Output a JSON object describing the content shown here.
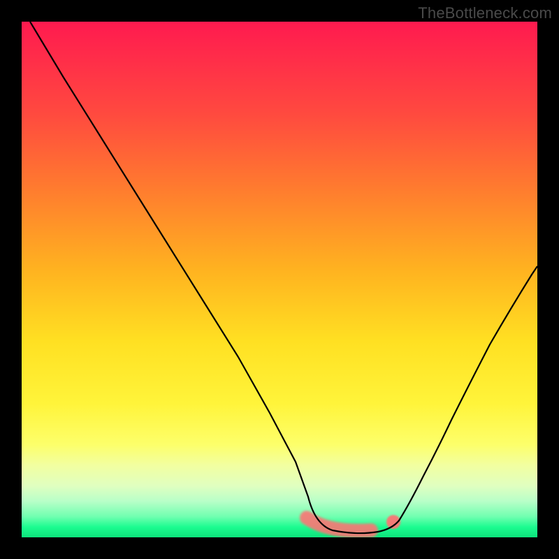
{
  "watermark": "TheBottleneck.com",
  "colors": {
    "background": "#000000",
    "gradient_top": "#ff1a4f",
    "gradient_mid": "#ffe022",
    "gradient_bottom": "#0ce47c",
    "curve": "#000000",
    "glow": "#fc7474"
  },
  "chart_data": {
    "type": "line",
    "title": "",
    "xlabel": "",
    "ylabel": "",
    "xlim": [
      0,
      100
    ],
    "ylim": [
      0,
      100
    ],
    "x": [
      0,
      5,
      10,
      15,
      20,
      25,
      30,
      35,
      40,
      45,
      50,
      55,
      56,
      57,
      58,
      59,
      60,
      62,
      64,
      66,
      68,
      70,
      72,
      74,
      76,
      78,
      80,
      85,
      90,
      95,
      100
    ],
    "values": [
      100,
      91,
      82,
      73,
      64,
      55,
      46,
      37,
      28,
      19,
      10,
      3,
      2,
      1,
      1,
      1,
      1,
      1,
      1,
      1,
      1,
      2,
      3,
      5,
      8,
      12,
      17,
      29,
      42,
      52,
      60
    ],
    "series": [
      {
        "name": "bottleneck-curve",
        "x": [
          0,
          5,
          10,
          15,
          20,
          25,
          30,
          35,
          40,
          45,
          50,
          55,
          56,
          57,
          58,
          59,
          60,
          62,
          64,
          66,
          68,
          70,
          72,
          74,
          76,
          78,
          80,
          85,
          90,
          95,
          100
        ],
        "y": [
          100,
          91,
          82,
          73,
          64,
          55,
          46,
          37,
          28,
          19,
          10,
          3,
          2,
          1,
          1,
          1,
          1,
          1,
          1,
          1,
          1,
          2,
          3,
          5,
          8,
          12,
          17,
          29,
          42,
          52,
          60
        ]
      }
    ],
    "background_gradient": {
      "stops": [
        {
          "pos": 0,
          "color": "#ff1a4f"
        },
        {
          "pos": 50,
          "color": "#ffe022"
        },
        {
          "pos": 100,
          "color": "#0ce47c"
        }
      ]
    },
    "highlight_region": {
      "x_start": 55,
      "x_end": 72,
      "note": "optimal zone glow"
    }
  }
}
